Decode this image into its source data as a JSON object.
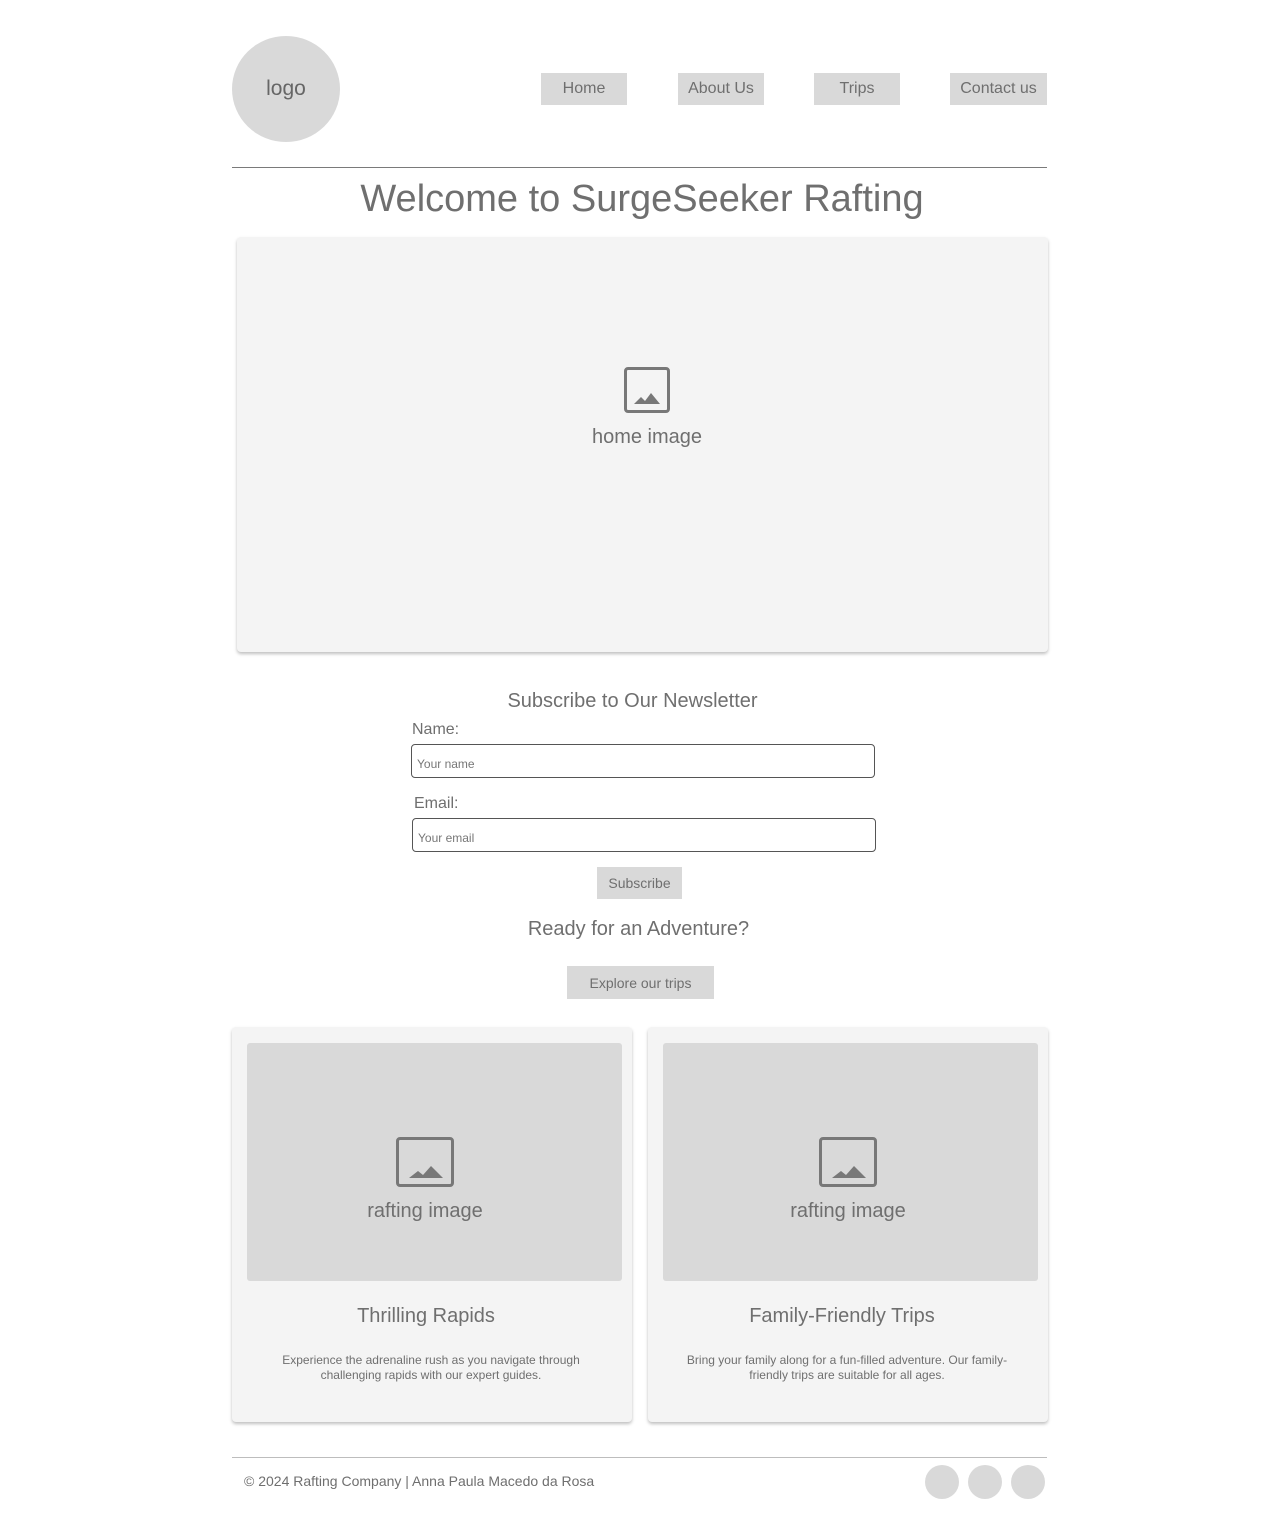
{
  "header": {
    "logo_text": "logo",
    "nav": {
      "home": "Home",
      "about": "About Us",
      "trips": "Trips",
      "contact": "Contact us"
    }
  },
  "main": {
    "title": "Welcome to SurgeSeeker Rafting",
    "hero_image_label": "home image"
  },
  "newsletter": {
    "title": "Subscribe to Our Newsletter",
    "name_label": "Name:",
    "name_placeholder": "Your name",
    "email_label": "Email:",
    "email_placeholder": "Your email",
    "subscribe_label": "Subscribe"
  },
  "cta": {
    "title": "Ready for an Adventure?",
    "button_label": "Explore our trips"
  },
  "cards": [
    {
      "image_label": "rafting image",
      "title": "Thrilling Rapids",
      "description": "Experience the adrenaline rush as you navigate through challenging rapids with our expert guides."
    },
    {
      "image_label": "rafting image",
      "title": "Family-Friendly Trips",
      "description": "Bring your family along for a fun-filled adventure. Our family-friendly trips are suitable for all ages."
    }
  ],
  "footer": {
    "text": "© 2024 Rafting Company | Anna Paula Macedo da Rosa"
  }
}
